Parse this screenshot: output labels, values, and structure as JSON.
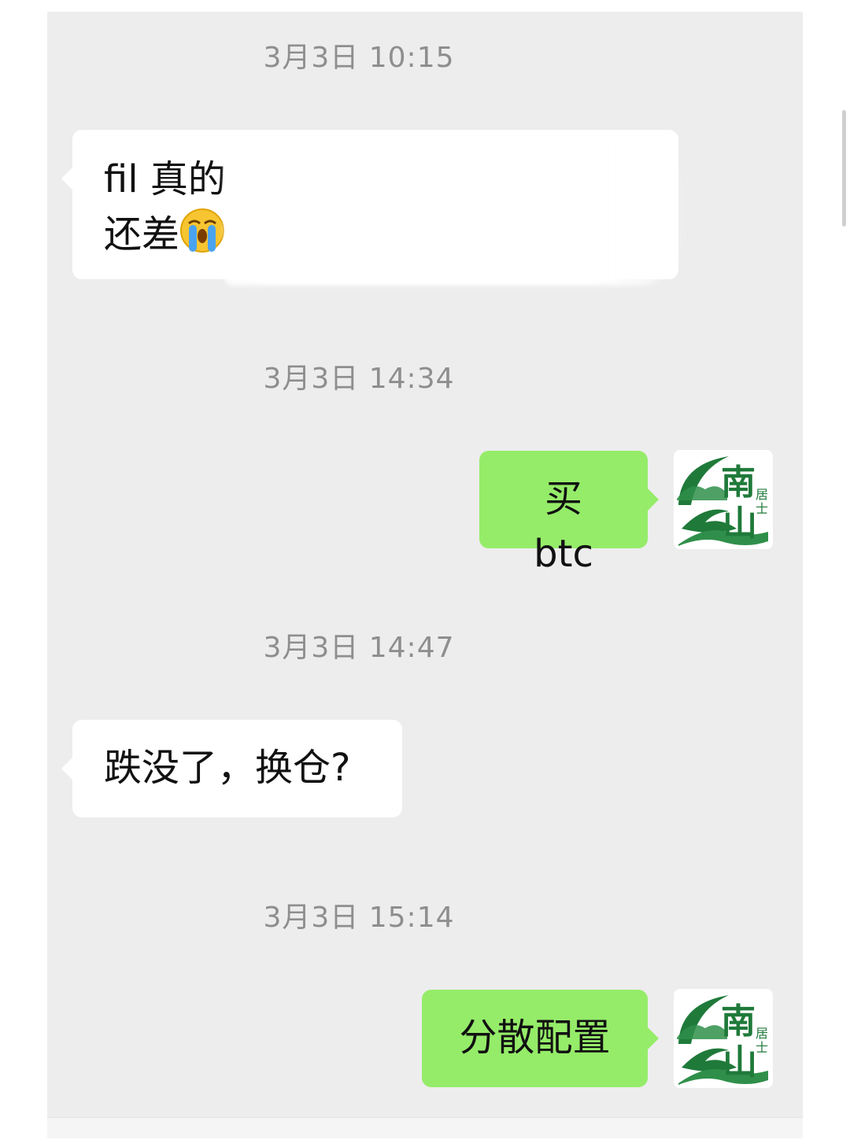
{
  "chat": {
    "messages": [
      {
        "type": "timestamp",
        "text": "3月3日 10:15"
      },
      {
        "type": "incoming",
        "line1": "fil 真的",
        "line2": "还差",
        "emoji": "loudly-crying-face"
      },
      {
        "type": "timestamp",
        "text": "3月3日 14:34"
      },
      {
        "type": "outgoing",
        "text": "买 btc",
        "avatar": "nanshan-jushi-logo"
      },
      {
        "type": "timestamp",
        "text": "3月3日 14:47"
      },
      {
        "type": "incoming",
        "text": "跌没了，换仓?"
      },
      {
        "type": "timestamp",
        "text": "3月3日 15:14"
      },
      {
        "type": "outgoing",
        "text": "分散配置",
        "avatar": "nanshan-jushi-logo"
      }
    ]
  },
  "avatar_logo": {
    "big_chars": [
      "南",
      "山"
    ],
    "small_chars": [
      "居",
      "士"
    ]
  },
  "colors": {
    "chat_background": "#ededed",
    "incoming_bubble": "#ffffff",
    "outgoing_bubble": "#95ec69",
    "timestamp_text": "#8e8e8e",
    "logo_green": "#1f7a3a"
  }
}
